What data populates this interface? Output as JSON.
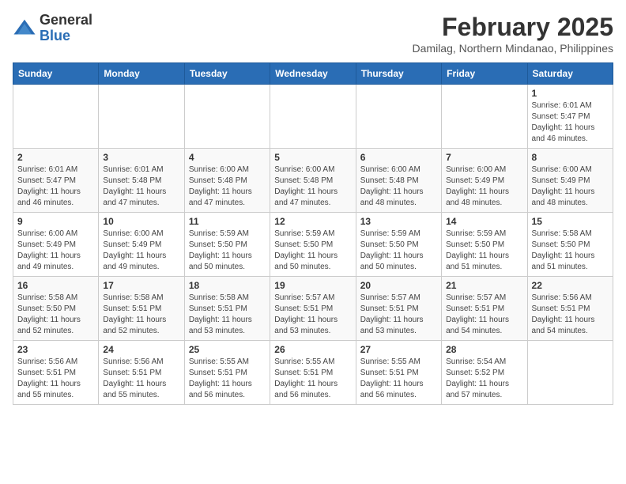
{
  "header": {
    "logo_general": "General",
    "logo_blue": "Blue",
    "month_year": "February 2025",
    "location": "Damilag, Northern Mindanao, Philippines"
  },
  "days_of_week": [
    "Sunday",
    "Monday",
    "Tuesday",
    "Wednesday",
    "Thursday",
    "Friday",
    "Saturday"
  ],
  "weeks": [
    [
      {
        "day": "",
        "info": ""
      },
      {
        "day": "",
        "info": ""
      },
      {
        "day": "",
        "info": ""
      },
      {
        "day": "",
        "info": ""
      },
      {
        "day": "",
        "info": ""
      },
      {
        "day": "",
        "info": ""
      },
      {
        "day": "1",
        "info": "Sunrise: 6:01 AM\nSunset: 5:47 PM\nDaylight: 11 hours\nand 46 minutes."
      }
    ],
    [
      {
        "day": "2",
        "info": "Sunrise: 6:01 AM\nSunset: 5:47 PM\nDaylight: 11 hours\nand 46 minutes."
      },
      {
        "day": "3",
        "info": "Sunrise: 6:01 AM\nSunset: 5:48 PM\nDaylight: 11 hours\nand 47 minutes."
      },
      {
        "day": "4",
        "info": "Sunrise: 6:00 AM\nSunset: 5:48 PM\nDaylight: 11 hours\nand 47 minutes."
      },
      {
        "day": "5",
        "info": "Sunrise: 6:00 AM\nSunset: 5:48 PM\nDaylight: 11 hours\nand 47 minutes."
      },
      {
        "day": "6",
        "info": "Sunrise: 6:00 AM\nSunset: 5:48 PM\nDaylight: 11 hours\nand 48 minutes."
      },
      {
        "day": "7",
        "info": "Sunrise: 6:00 AM\nSunset: 5:49 PM\nDaylight: 11 hours\nand 48 minutes."
      },
      {
        "day": "8",
        "info": "Sunrise: 6:00 AM\nSunset: 5:49 PM\nDaylight: 11 hours\nand 48 minutes."
      }
    ],
    [
      {
        "day": "9",
        "info": "Sunrise: 6:00 AM\nSunset: 5:49 PM\nDaylight: 11 hours\nand 49 minutes."
      },
      {
        "day": "10",
        "info": "Sunrise: 6:00 AM\nSunset: 5:49 PM\nDaylight: 11 hours\nand 49 minutes."
      },
      {
        "day": "11",
        "info": "Sunrise: 5:59 AM\nSunset: 5:50 PM\nDaylight: 11 hours\nand 50 minutes."
      },
      {
        "day": "12",
        "info": "Sunrise: 5:59 AM\nSunset: 5:50 PM\nDaylight: 11 hours\nand 50 minutes."
      },
      {
        "day": "13",
        "info": "Sunrise: 5:59 AM\nSunset: 5:50 PM\nDaylight: 11 hours\nand 50 minutes."
      },
      {
        "day": "14",
        "info": "Sunrise: 5:59 AM\nSunset: 5:50 PM\nDaylight: 11 hours\nand 51 minutes."
      },
      {
        "day": "15",
        "info": "Sunrise: 5:58 AM\nSunset: 5:50 PM\nDaylight: 11 hours\nand 51 minutes."
      }
    ],
    [
      {
        "day": "16",
        "info": "Sunrise: 5:58 AM\nSunset: 5:50 PM\nDaylight: 11 hours\nand 52 minutes."
      },
      {
        "day": "17",
        "info": "Sunrise: 5:58 AM\nSunset: 5:51 PM\nDaylight: 11 hours\nand 52 minutes."
      },
      {
        "day": "18",
        "info": "Sunrise: 5:58 AM\nSunset: 5:51 PM\nDaylight: 11 hours\nand 53 minutes."
      },
      {
        "day": "19",
        "info": "Sunrise: 5:57 AM\nSunset: 5:51 PM\nDaylight: 11 hours\nand 53 minutes."
      },
      {
        "day": "20",
        "info": "Sunrise: 5:57 AM\nSunset: 5:51 PM\nDaylight: 11 hours\nand 53 minutes."
      },
      {
        "day": "21",
        "info": "Sunrise: 5:57 AM\nSunset: 5:51 PM\nDaylight: 11 hours\nand 54 minutes."
      },
      {
        "day": "22",
        "info": "Sunrise: 5:56 AM\nSunset: 5:51 PM\nDaylight: 11 hours\nand 54 minutes."
      }
    ],
    [
      {
        "day": "23",
        "info": "Sunrise: 5:56 AM\nSunset: 5:51 PM\nDaylight: 11 hours\nand 55 minutes."
      },
      {
        "day": "24",
        "info": "Sunrise: 5:56 AM\nSunset: 5:51 PM\nDaylight: 11 hours\nand 55 minutes."
      },
      {
        "day": "25",
        "info": "Sunrise: 5:55 AM\nSunset: 5:51 PM\nDaylight: 11 hours\nand 56 minutes."
      },
      {
        "day": "26",
        "info": "Sunrise: 5:55 AM\nSunset: 5:51 PM\nDaylight: 11 hours\nand 56 minutes."
      },
      {
        "day": "27",
        "info": "Sunrise: 5:55 AM\nSunset: 5:51 PM\nDaylight: 11 hours\nand 56 minutes."
      },
      {
        "day": "28",
        "info": "Sunrise: 5:54 AM\nSunset: 5:52 PM\nDaylight: 11 hours\nand 57 minutes."
      },
      {
        "day": "",
        "info": ""
      }
    ]
  ]
}
